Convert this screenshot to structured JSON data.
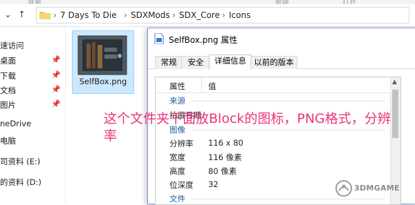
{
  "ribbon": {
    "labels": [
      "查看",
      "新建",
      "打开"
    ]
  },
  "address": {
    "path": [
      "7 Days To Die",
      "SDXMods",
      "SDX_Core",
      "Icons"
    ],
    "separator": "›"
  },
  "nav_pane": {
    "items": [
      {
        "label": "速访问",
        "pinned": false
      },
      {
        "label": "桌面",
        "pinned": true
      },
      {
        "label": "下载",
        "pinned": true
      },
      {
        "label": "文档",
        "pinned": true
      },
      {
        "label": "图片",
        "pinned": true
      },
      {
        "label": "neDrive",
        "pinned": false
      },
      {
        "label": "电脑",
        "pinned": false
      },
      {
        "label": "司资料 (E:)",
        "pinned": false
      },
      {
        "label": "的资料 (D:)",
        "pinned": false
      }
    ]
  },
  "file": {
    "name": "SelfBox.png"
  },
  "dialog": {
    "title": "SelfBox.png 属性",
    "tabs": [
      {
        "label": "常规",
        "active": false
      },
      {
        "label": "安全",
        "active": false
      },
      {
        "label": "详细信息",
        "active": true
      },
      {
        "label": "以前的版本",
        "active": false
      }
    ],
    "columns": {
      "property": "属性",
      "value": "值"
    },
    "rows": [
      {
        "kind": "group",
        "label": "来源"
      },
      {
        "kind": "prop",
        "name": "拍摄日期",
        "value": ""
      },
      {
        "kind": "group",
        "label": "图像"
      },
      {
        "kind": "prop",
        "name": "分辨率",
        "value": "116 x 80"
      },
      {
        "kind": "prop",
        "name": "宽度",
        "value": "116 像素"
      },
      {
        "kind": "prop",
        "name": "高度",
        "value": "80 像素"
      },
      {
        "kind": "prop",
        "name": "位深度",
        "value": "32"
      },
      {
        "kind": "group",
        "label": "文件"
      }
    ]
  },
  "annotation": {
    "text": "这个文件夹下面放Block的图标，PNG格式，分辨率"
  },
  "watermark": {
    "text": "3DMGAME"
  },
  "colors": {
    "annotation": "#e8347a",
    "group_label": "#1e5aa8",
    "selection": "#cce8ff"
  }
}
